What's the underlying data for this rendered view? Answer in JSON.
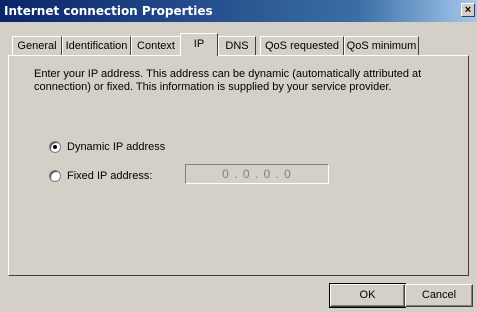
{
  "window": {
    "title": "Internet connection Properties",
    "close_glyph": "×",
    "close_icon": "close-icon"
  },
  "tabs": [
    {
      "label": "General",
      "active": false
    },
    {
      "label": "Identification",
      "active": false
    },
    {
      "label": "Context",
      "active": false
    },
    {
      "label": "IP",
      "active": true
    },
    {
      "label": "DNS",
      "active": false
    },
    {
      "label": "QoS requested",
      "active": false
    },
    {
      "label": "QoS minimum",
      "active": false
    }
  ],
  "ip_tab": {
    "intro": "Enter your IP address. This address can be dynamic (automatically attributed at connection) or fixed. This information is supplied by your service provider.",
    "dynamic_label": "Dynamic IP address",
    "dynamic_checked": true,
    "fixed_label": "Fixed IP address:",
    "fixed_checked": false,
    "fixed_value": "0 . 0 . 0 . 0"
  },
  "buttons": {
    "ok": "OK",
    "cancel": "Cancel"
  }
}
